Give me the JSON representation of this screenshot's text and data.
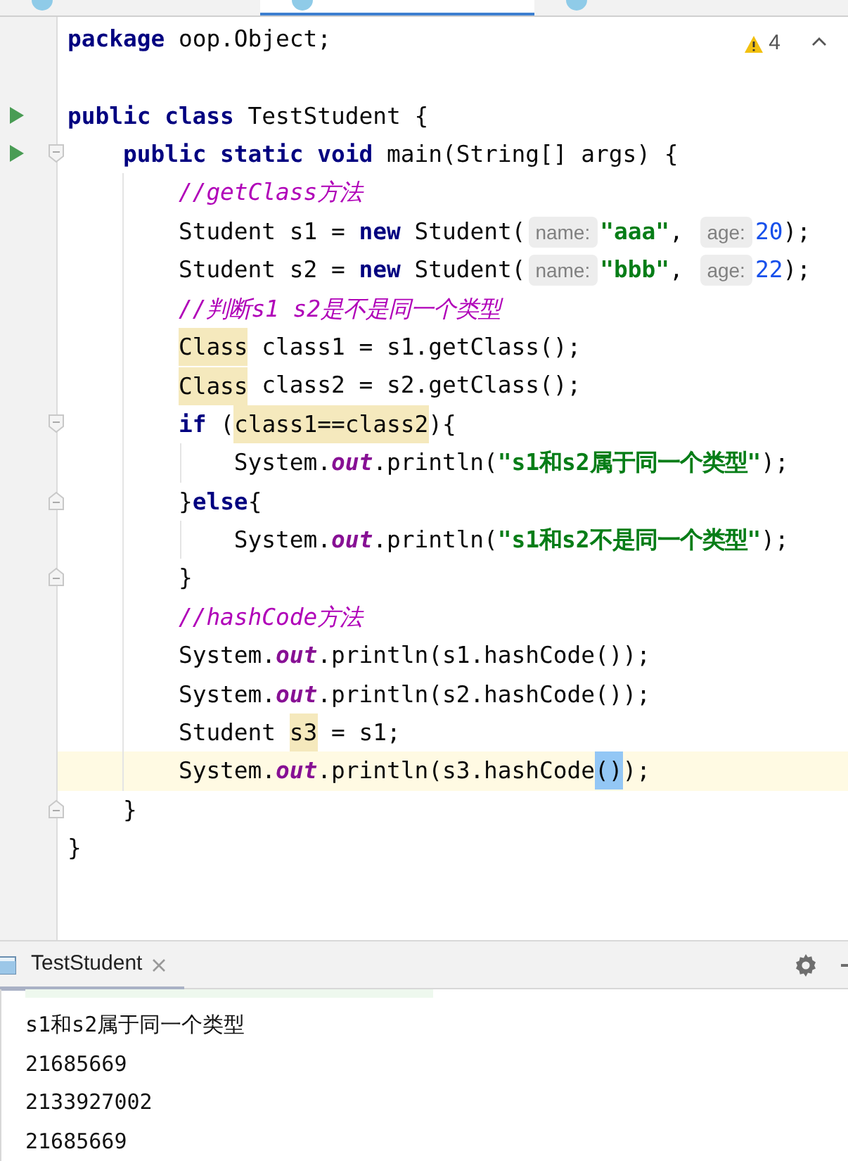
{
  "editor_tabs": [
    {
      "selected": false
    },
    {
      "selected": true
    },
    {
      "selected": false
    }
  ],
  "inspection": {
    "warnings": "4"
  },
  "code_lines": [
    {
      "run": false,
      "current": false,
      "tokens": [
        {
          "text": "package",
          "kind": "kw"
        },
        {
          "text": " oop.Object;",
          "kind": "plain"
        }
      ]
    },
    {
      "run": false,
      "current": false
    },
    {
      "run": true,
      "current": false,
      "tokens": [
        {
          "text": "public class",
          "kind": "kw"
        },
        {
          "text": " TestStudent {",
          "kind": "plain"
        }
      ]
    },
    {
      "run": true,
      "current": false,
      "fold_start": true,
      "tokens": [
        {
          "text": "    public static void",
          "kind": "kw"
        },
        {
          "text": " main(String[] args) {",
          "kind": "plain"
        }
      ]
    },
    {
      "run": false,
      "current": false,
      "tokens": [
        {
          "text": "        //getClass方法",
          "kind": "comment"
        }
      ]
    },
    {
      "run": false,
      "current": false,
      "tokens": [
        {
          "text": "        Student s1 = ",
          "kind": "plain"
        },
        {
          "text": "new",
          "kind": "kw"
        },
        {
          "text": " Student(",
          "kind": "plain"
        },
        {
          "text": "name:",
          "kind": "hint"
        },
        {
          "text": "\"aaa\"",
          "kind": "str"
        },
        {
          "text": ", ",
          "kind": "plain"
        },
        {
          "text": "age:",
          "kind": "hint"
        },
        {
          "text": "20",
          "kind": "num"
        },
        {
          "text": ");",
          "kind": "plain"
        }
      ]
    },
    {
      "run": false,
      "current": false,
      "tokens": [
        {
          "text": "        Student s2 = ",
          "kind": "plain"
        },
        {
          "text": "new",
          "kind": "kw"
        },
        {
          "text": " Student(",
          "kind": "plain"
        },
        {
          "text": "name:",
          "kind": "hint"
        },
        {
          "text": "\"bbb\"",
          "kind": "str"
        },
        {
          "text": ", ",
          "kind": "plain"
        },
        {
          "text": "age:",
          "kind": "hint"
        },
        {
          "text": "22",
          "kind": "num"
        },
        {
          "text": ");",
          "kind": "plain"
        }
      ]
    },
    {
      "run": false,
      "current": false,
      "tokens": [
        {
          "text": "        //判断s1 s2是不是同一个类型",
          "kind": "comment"
        }
      ]
    },
    {
      "run": false,
      "current": false,
      "tokens": [
        {
          "text": "        Class",
          "kind": "hl"
        },
        {
          "text": " class1 = s1.getClass();",
          "kind": "plain"
        }
      ]
    },
    {
      "run": false,
      "current": false,
      "tokens": [
        {
          "text": "        Class",
          "kind": "hl"
        },
        {
          "text": " class2 = s2.getClass();",
          "kind": "plain"
        }
      ]
    },
    {
      "run": false,
      "current": false,
      "fold_start": true,
      "tokens": [
        {
          "text": "        if",
          "kind": "kw"
        },
        {
          "text": " (",
          "kind": "plain"
        },
        {
          "text": "class1==class2",
          "kind": "hl"
        },
        {
          "text": "){",
          "kind": "plain"
        }
      ]
    },
    {
      "run": false,
      "current": false,
      "tokens": [
        {
          "text": "            System.",
          "kind": "plain"
        },
        {
          "text": "out",
          "kind": "field"
        },
        {
          "text": ".println(",
          "kind": "plain"
        },
        {
          "text": "\"s1和s2属于同一个类型\"",
          "kind": "str"
        },
        {
          "text": ");",
          "kind": "plain"
        }
      ]
    },
    {
      "run": false,
      "current": false,
      "fold_end": true,
      "tokens": [
        {
          "text": "        }",
          "kind": "plain"
        },
        {
          "text": "else",
          "kind": "kw"
        },
        {
          "text": "{",
          "kind": "plain"
        }
      ]
    },
    {
      "run": false,
      "current": false,
      "tokens": [
        {
          "text": "            System.",
          "kind": "plain"
        },
        {
          "text": "out",
          "kind": "field"
        },
        {
          "text": ".println(",
          "kind": "plain"
        },
        {
          "text": "\"s1和s2不是同一个类型\"",
          "kind": "str"
        },
        {
          "text": ");",
          "kind": "plain"
        }
      ]
    },
    {
      "run": false,
      "current": false,
      "fold_end": true,
      "tokens": [
        {
          "text": "        }",
          "kind": "plain"
        }
      ]
    },
    {
      "run": false,
      "current": false,
      "tokens": [
        {
          "text": "        //hashCode方法",
          "kind": "comment"
        }
      ]
    },
    {
      "run": false,
      "current": false,
      "tokens": [
        {
          "text": "        System.",
          "kind": "plain"
        },
        {
          "text": "out",
          "kind": "field"
        },
        {
          "text": ".println(s1.hashCode());",
          "kind": "plain"
        }
      ]
    },
    {
      "run": false,
      "current": false,
      "tokens": [
        {
          "text": "        System.",
          "kind": "plain"
        },
        {
          "text": "out",
          "kind": "field"
        },
        {
          "text": ".println(s2.hashCode());",
          "kind": "plain"
        }
      ]
    },
    {
      "run": false,
      "current": false,
      "tokens": [
        {
          "text": "        Student ",
          "kind": "plain"
        },
        {
          "text": "s3",
          "kind": "hl"
        },
        {
          "text": " = s1;",
          "kind": "plain"
        }
      ]
    },
    {
      "run": false,
      "current": true,
      "tokens": [
        {
          "text": "        System.",
          "kind": "plain"
        },
        {
          "text": "out",
          "kind": "field"
        },
        {
          "text": ".println(s3.hashCode",
          "kind": "plain"
        },
        {
          "text": "()",
          "kind": "match"
        },
        {
          "text": ");",
          "kind": "plain"
        }
      ]
    },
    {
      "run": false,
      "current": false,
      "fold_end": true,
      "tokens": [
        {
          "text": "    }",
          "kind": "plain"
        }
      ]
    },
    {
      "run": false,
      "current": false,
      "tokens": [
        {
          "text": "}",
          "kind": "plain"
        }
      ]
    }
  ],
  "run_panel": {
    "tab": "TestStudent",
    "output": [
      "s1和s2属于同一个类型",
      "21685669",
      "2133927002",
      "21685669"
    ]
  }
}
